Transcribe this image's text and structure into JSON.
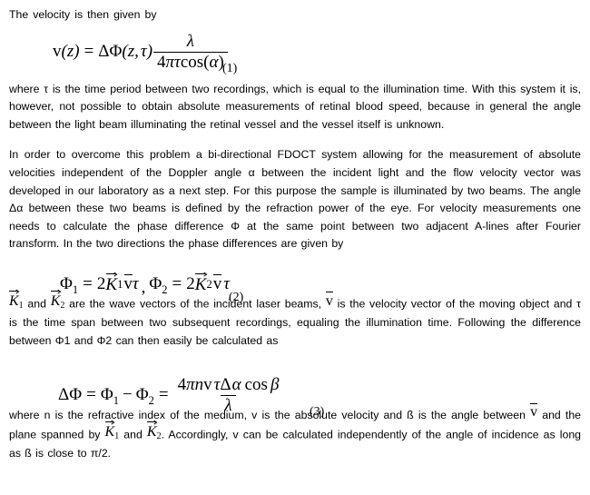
{
  "document": {
    "paragraphs": {
      "intro": "The velocity is then given by",
      "after_eq1": "where τ is the time period between two recordings, which is equal to the illumination time. With this system it is, however, not possible to obtain absolute measurements of retinal blood speed, because in general the angle between the light beam illuminating the retinal vessel and the vessel itself is unknown.",
      "before_eq2": "In order to overcome this problem a bi-directional FDOCT system allowing for the measurement of absolute velocities independent of the Doppler angle α between the incident light and the flow velocity vector was developed in our laboratory as a next step. For this purpose the sample is illuminated by two beams. The angle Δα between these two beams is defined by the refraction power of the eye. For velocity measurements one needs to calculate the phase difference Φ at the same point between two adjacent A-lines after Fourier transform. In the two directions the phase differences are given by",
      "after_eq2_part1": " and ",
      "after_eq2_part2": " are the wave vectors of the incident laser beams, ",
      "after_eq2_part3": " is the velocity vector of the moving object and τ is the time span between two subsequent recordings, equaling the illumination time. Following the difference between Φ1 and Φ2 can then easily be calculated as",
      "after_eq3_part1": "where n is the refractive index of the medium, v is the absolute velocity and ß is the angle between ",
      "after_eq3_part2": " and the plane spanned by ",
      "after_eq3_part3": " and ",
      "after_eq3_part4": ". Accordingly, v can be calculated independently of the angle of incidence as long as ß is close to π/2."
    },
    "equations": [
      {
        "id": "eq1",
        "number": "(1)",
        "plain": "v(z) = ΔΦ(z,τ) λ / (4πτcos(α))",
        "lhs": "v(z)",
        "equals": "=",
        "rhs_prefix": "ΔΦ(z,τ)",
        "numerator": "λ",
        "denominator_pre": "4",
        "denominator_pi": "π",
        "denominator_tau": "τ",
        "denominator_cos": "cos(",
        "denominator_alpha": "α",
        "denominator_close": ")",
        "var_v": "v",
        "paren_open": "(",
        "var_z": "z",
        "paren_close": ")",
        "delta_phi": "ΔΦ",
        "arg_z": "z",
        "arg_comma": ",",
        "arg_tau": "τ"
      },
      {
        "id": "eq2",
        "number": "(2)",
        "plain": "Φ₁ = 2K⃗1 v⃗ τ , Φ₂ = 2K⃗2 v⃗ τ",
        "phi": "Φ",
        "sub1": "1",
        "sub2": "2",
        "equals": "=",
        "two": "2",
        "K": "K",
        "v": "v",
        "tau": "τ",
        "comma": ","
      },
      {
        "id": "eq3",
        "number": "(3)",
        "plain": "ΔΦ = Φ₁ − Φ₂ = 4πnvτΔα cosß / λ",
        "delta_phi": "ΔΦ",
        "equals": "=",
        "phi": "Φ",
        "sub1": "1",
        "sub2": "2",
        "minus": "−",
        "num_four": "4",
        "num_pi": "π",
        "num_n": "n",
        "num_v": "v",
        "num_tau": "τ",
        "num_delta": "Δ",
        "num_alpha": "α",
        "num_cos": "cos",
        "num_beta": "β",
        "denominator": "λ"
      }
    ],
    "inline_symbols": {
      "K": "K",
      "sub1": "1",
      "sub2": "2",
      "v": "v"
    }
  }
}
